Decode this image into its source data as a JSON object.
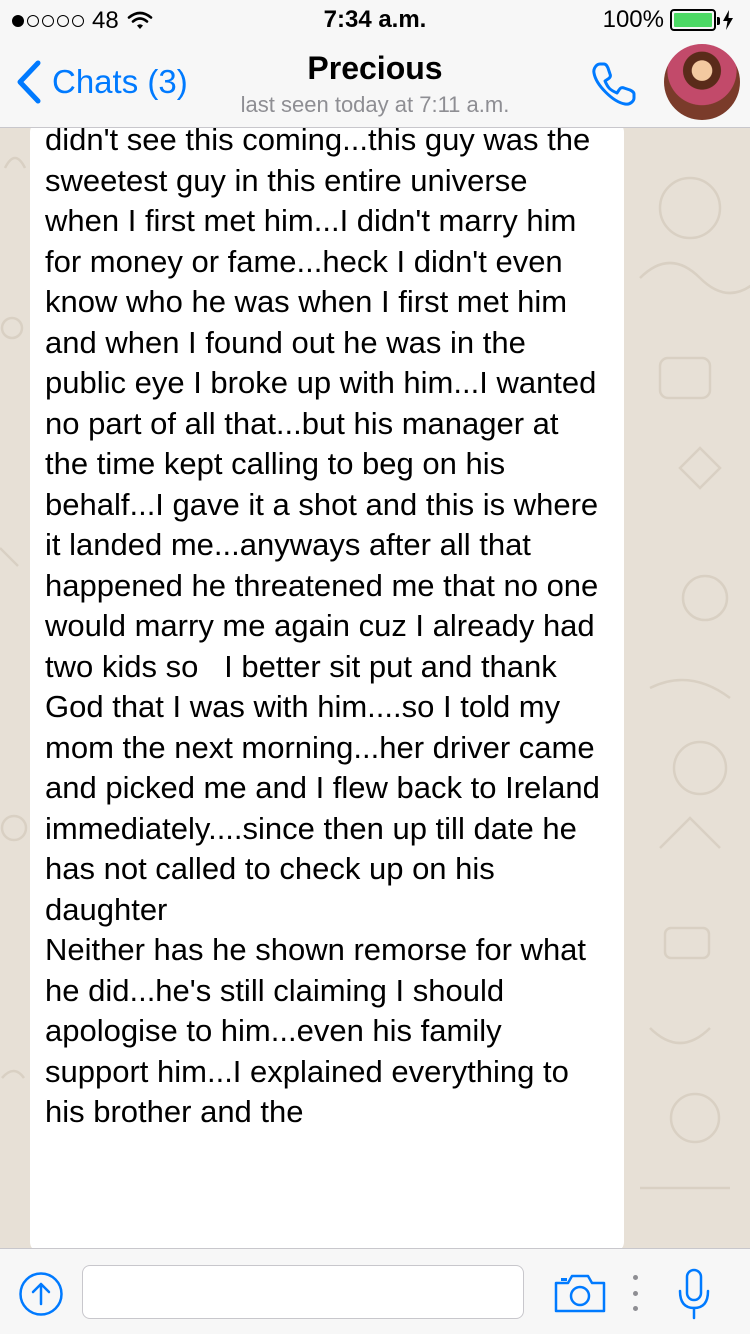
{
  "status_bar": {
    "carrier": "48",
    "time": "7:34 a.m.",
    "battery": "100%",
    "signal_bars_filled": 1,
    "signal_bars_total": 5
  },
  "header": {
    "back_label": "Chats (3)",
    "contact_name": "Precious",
    "last_seen": "last seen today at 7:11 a.m."
  },
  "message": {
    "text": "didn't see this coming...this guy was the sweetest guy in this entire universe when I first met him...I didn't marry him for money or fame...heck I didn't even know who he was when I first met him and when I found out he was in the public eye I broke up with him...I wanted no part of all that...but his manager at the time kept calling to beg on his behalf...I gave it a shot and this is where it landed me...anyways after all that happened he threatened me that no one would marry me again cuz I already had two kids so   I better sit put and thank God that I was with him....so I told my mom the next morning...her driver came and picked me and I flew back to Ireland immediately....since then up till date he has not called to check up on his daughter\nNeither has he shown remorse for what he did...he's still claiming I should apologise to him...even his family support him...I explained everything to his brother and the"
  },
  "input": {
    "value": "",
    "placeholder": ""
  },
  "colors": {
    "accent": "#007aff",
    "battery": "#4cd964",
    "chat_background": "#e7e0d6"
  },
  "icons": {
    "back": "chevron-left-icon",
    "call": "phone-icon",
    "upload": "arrow-up-circle-icon",
    "camera": "camera-icon",
    "more": "more-vertical-icon",
    "mic": "microphone-icon"
  }
}
